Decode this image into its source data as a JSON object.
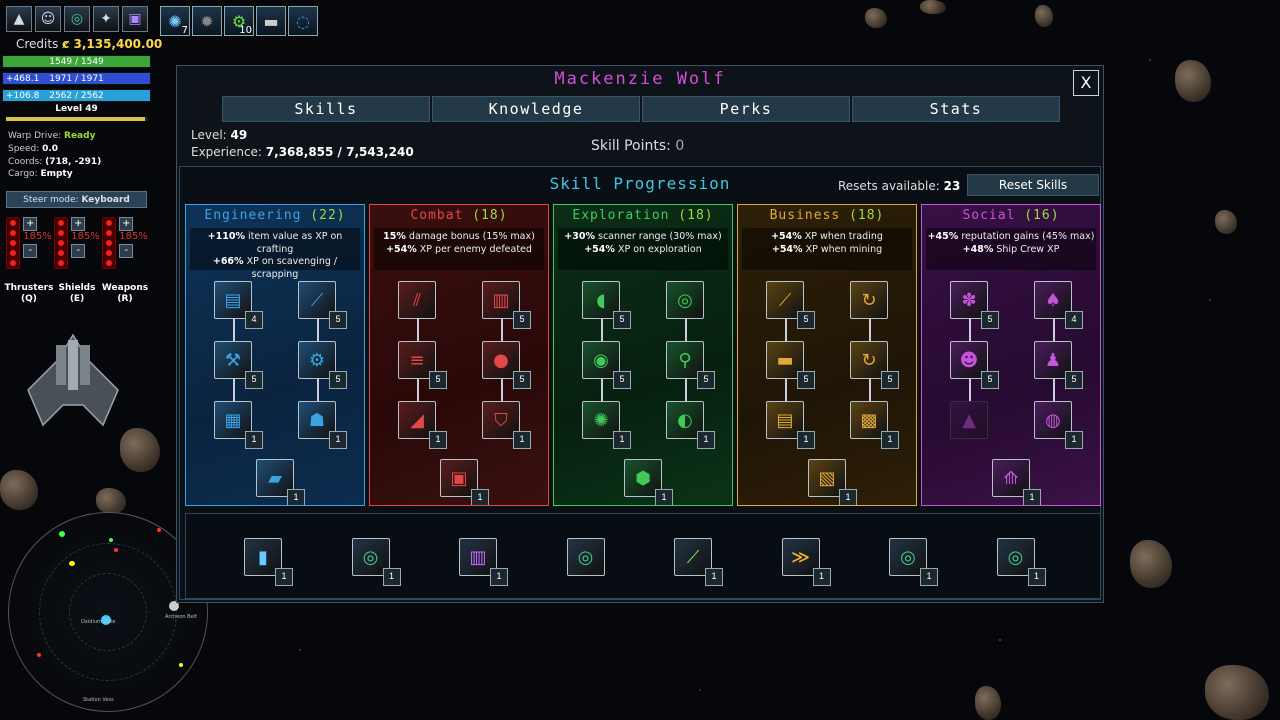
{
  "hud": {
    "top_icons": [
      "ship-icon",
      "crew-icon",
      "radar-icon",
      "map-icon",
      "codex-icon"
    ],
    "abilities": [
      {
        "name": "shield-boost-icon",
        "count": "7"
      },
      {
        "name": "asteroid-icon",
        "count": ""
      },
      {
        "name": "gear-icon",
        "count": "10"
      },
      {
        "name": "drone-icon",
        "count": ""
      },
      {
        "name": "warp-ring-icon",
        "count": ""
      }
    ],
    "credits_label": "Credits",
    "credits_value": "ȼ 3,135,400.00",
    "hull": "1549 / 1549",
    "shield_regen": "+468.1",
    "shield": "1971 / 1971",
    "energy_regen": "+106.8",
    "energy": "2562 / 2562",
    "level": "Level 49",
    "xp_fraction": 0.977,
    "status": {
      "warp_label": "Warp Drive:",
      "warp_value": "Ready",
      "speed_label": "Speed:",
      "speed_value": "0.0",
      "coords_label": "Coords:",
      "coords_value": "(718, -291)",
      "cargo_label": "Cargo:",
      "cargo_value": "Empty"
    },
    "steer_label": "Steer mode:",
    "steer_value": "Keyboard",
    "subsystems": [
      {
        "pct": "185%",
        "name": "Thrusters",
        "key": "(Q)"
      },
      {
        "pct": "185%",
        "name": "Shields",
        "key": "(E)"
      },
      {
        "pct": "185%",
        "name": "Weapons",
        "key": "(R)"
      }
    ],
    "minimap_labels": [
      "Oxidium Gate",
      "Archeon Belt",
      "Station Vess"
    ]
  },
  "panel": {
    "character_name": "Mackenzie Wolf",
    "close_label": "X",
    "tabs": [
      "Skills",
      "Knowledge",
      "Perks",
      "Stats"
    ],
    "level_label": "Level:",
    "level_value": "49",
    "experience_label": "Experience:",
    "experience_value": "7,368,855 / 7,543,240",
    "skill_points_label": "Skill Points:",
    "skill_points_value": "0",
    "progression_title": "Skill Progression",
    "resets_label": "Resets available:",
    "resets_value": "23",
    "reset_button": "Reset Skills"
  },
  "trees": [
    {
      "name": "Engineering",
      "points": "(22)",
      "color": "#3aa3e6",
      "pct1": "+110%",
      "text1": " item value as XP on crafting",
      "pct2": "+66%",
      "text2": " XP on scavenging / scrapping"
    },
    {
      "name": "Combat",
      "points": "(18)",
      "color": "#e24848",
      "pct1": "15%",
      "text1": " damage bonus (15% max)",
      "pct2": "+54%",
      "text2": " XP per enemy defeated"
    },
    {
      "name": "Exploration",
      "points": "(18)",
      "color": "#43c95a",
      "pct1": "+30%",
      "text1": " scanner range (30% max)",
      "pct2": "+54%",
      "text2": " XP on exploration"
    },
    {
      "name": "Business",
      "points": "(18)",
      "color": "#e0a838",
      "pct1": "+54%",
      "text1": " XP when trading",
      "pct2": "+54%",
      "text2": " XP when mining"
    },
    {
      "name": "Social",
      "points": "(16)",
      "color": "#c455d8",
      "pct1": "+45%",
      "text1": " reputation gains (45% max)",
      "pct2": "+48%",
      "text2": " Ship Crew XP"
    }
  ],
  "tree_nodes": [
    [
      {
        "icon": "crate-icon",
        "count": "4"
      },
      {
        "icon": "cutter-icon",
        "count": "5"
      },
      {
        "icon": "robot-arm-icon",
        "count": "5"
      },
      {
        "icon": "drill-icon",
        "count": "5"
      },
      {
        "icon": "chip-icon",
        "count": "1"
      },
      {
        "icon": "lamp-icon",
        "count": "1"
      },
      {
        "icon": "engine-icon",
        "count": "1"
      }
    ],
    [
      {
        "icon": "blade-icon",
        "count": ""
      },
      {
        "icon": "armor-icon",
        "count": "5"
      },
      {
        "icon": "gatling-icon",
        "count": "5"
      },
      {
        "icon": "plasma-icon",
        "count": "5"
      },
      {
        "icon": "beam-icon",
        "count": "1"
      },
      {
        "icon": "shield-icon",
        "count": "1"
      },
      {
        "icon": "turret-icon",
        "count": "1"
      }
    ],
    [
      {
        "icon": "thruster-icon",
        "count": "5"
      },
      {
        "icon": "radar-icon",
        "count": ""
      },
      {
        "icon": "vortex-icon",
        "count": "5"
      },
      {
        "icon": "probe-icon",
        "count": "5"
      },
      {
        "icon": "nebula-icon",
        "count": "1"
      },
      {
        "icon": "planet-icon",
        "count": "1"
      },
      {
        "icon": "cargo-pod-icon",
        "count": "1"
      }
    ],
    [
      {
        "icon": "laser-icon",
        "count": "5"
      },
      {
        "icon": "cycle-icon",
        "count": ""
      },
      {
        "icon": "gold-bars-icon",
        "count": "5"
      },
      {
        "icon": "trade-cycle-icon",
        "count": "5"
      },
      {
        "icon": "contract-icon",
        "count": "1"
      },
      {
        "icon": "storage-icon",
        "count": "1"
      },
      {
        "icon": "vault-icon",
        "count": "1"
      }
    ],
    [
      {
        "icon": "paw-icon",
        "count": "5"
      },
      {
        "icon": "card-icon",
        "count": "4"
      },
      {
        "icon": "face-icon",
        "count": "5"
      },
      {
        "icon": "ghost-icon",
        "count": "5"
      },
      {
        "icon": "locked-icon",
        "count": ""
      },
      {
        "icon": "sphere-icon",
        "count": "1"
      },
      {
        "icon": "rocket-badge-icon",
        "count": "1"
      }
    ]
  ],
  "equipped": [
    {
      "icon": "canister-icon",
      "count": "1"
    },
    {
      "icon": "radar-icon",
      "count": "1"
    },
    {
      "icon": "armor-icon",
      "count": "1"
    },
    {
      "icon": "radar-icon",
      "count": ""
    },
    {
      "icon": "laser-icon",
      "count": "1"
    },
    {
      "icon": "rank-chevron-icon",
      "count": "1"
    },
    {
      "icon": "radar-icon",
      "count": "1"
    },
    {
      "icon": "radar-icon",
      "count": "1"
    }
  ]
}
